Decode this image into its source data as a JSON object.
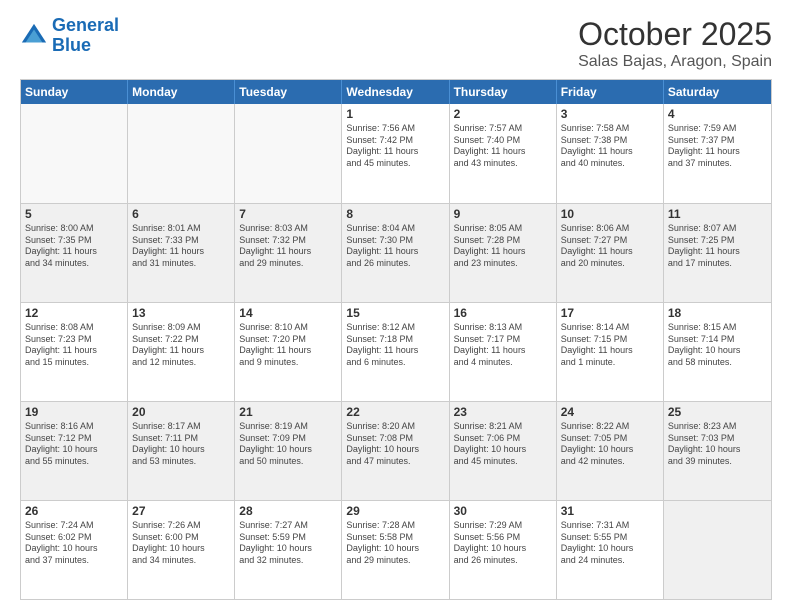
{
  "header": {
    "logo_line1": "General",
    "logo_line2": "Blue",
    "month": "October 2025",
    "location": "Salas Bajas, Aragon, Spain"
  },
  "weekdays": [
    "Sunday",
    "Monday",
    "Tuesday",
    "Wednesday",
    "Thursday",
    "Friday",
    "Saturday"
  ],
  "rows": [
    [
      {
        "day": "",
        "text": ""
      },
      {
        "day": "",
        "text": ""
      },
      {
        "day": "",
        "text": ""
      },
      {
        "day": "1",
        "text": "Sunrise: 7:56 AM\nSunset: 7:42 PM\nDaylight: 11 hours\nand 45 minutes."
      },
      {
        "day": "2",
        "text": "Sunrise: 7:57 AM\nSunset: 7:40 PM\nDaylight: 11 hours\nand 43 minutes."
      },
      {
        "day": "3",
        "text": "Sunrise: 7:58 AM\nSunset: 7:38 PM\nDaylight: 11 hours\nand 40 minutes."
      },
      {
        "day": "4",
        "text": "Sunrise: 7:59 AM\nSunset: 7:37 PM\nDaylight: 11 hours\nand 37 minutes."
      }
    ],
    [
      {
        "day": "5",
        "text": "Sunrise: 8:00 AM\nSunset: 7:35 PM\nDaylight: 11 hours\nand 34 minutes."
      },
      {
        "day": "6",
        "text": "Sunrise: 8:01 AM\nSunset: 7:33 PM\nDaylight: 11 hours\nand 31 minutes."
      },
      {
        "day": "7",
        "text": "Sunrise: 8:03 AM\nSunset: 7:32 PM\nDaylight: 11 hours\nand 29 minutes."
      },
      {
        "day": "8",
        "text": "Sunrise: 8:04 AM\nSunset: 7:30 PM\nDaylight: 11 hours\nand 26 minutes."
      },
      {
        "day": "9",
        "text": "Sunrise: 8:05 AM\nSunset: 7:28 PM\nDaylight: 11 hours\nand 23 minutes."
      },
      {
        "day": "10",
        "text": "Sunrise: 8:06 AM\nSunset: 7:27 PM\nDaylight: 11 hours\nand 20 minutes."
      },
      {
        "day": "11",
        "text": "Sunrise: 8:07 AM\nSunset: 7:25 PM\nDaylight: 11 hours\nand 17 minutes."
      }
    ],
    [
      {
        "day": "12",
        "text": "Sunrise: 8:08 AM\nSunset: 7:23 PM\nDaylight: 11 hours\nand 15 minutes."
      },
      {
        "day": "13",
        "text": "Sunrise: 8:09 AM\nSunset: 7:22 PM\nDaylight: 11 hours\nand 12 minutes."
      },
      {
        "day": "14",
        "text": "Sunrise: 8:10 AM\nSunset: 7:20 PM\nDaylight: 11 hours\nand 9 minutes."
      },
      {
        "day": "15",
        "text": "Sunrise: 8:12 AM\nSunset: 7:18 PM\nDaylight: 11 hours\nand 6 minutes."
      },
      {
        "day": "16",
        "text": "Sunrise: 8:13 AM\nSunset: 7:17 PM\nDaylight: 11 hours\nand 4 minutes."
      },
      {
        "day": "17",
        "text": "Sunrise: 8:14 AM\nSunset: 7:15 PM\nDaylight: 11 hours\nand 1 minute."
      },
      {
        "day": "18",
        "text": "Sunrise: 8:15 AM\nSunset: 7:14 PM\nDaylight: 10 hours\nand 58 minutes."
      }
    ],
    [
      {
        "day": "19",
        "text": "Sunrise: 8:16 AM\nSunset: 7:12 PM\nDaylight: 10 hours\nand 55 minutes."
      },
      {
        "day": "20",
        "text": "Sunrise: 8:17 AM\nSunset: 7:11 PM\nDaylight: 10 hours\nand 53 minutes."
      },
      {
        "day": "21",
        "text": "Sunrise: 8:19 AM\nSunset: 7:09 PM\nDaylight: 10 hours\nand 50 minutes."
      },
      {
        "day": "22",
        "text": "Sunrise: 8:20 AM\nSunset: 7:08 PM\nDaylight: 10 hours\nand 47 minutes."
      },
      {
        "day": "23",
        "text": "Sunrise: 8:21 AM\nSunset: 7:06 PM\nDaylight: 10 hours\nand 45 minutes."
      },
      {
        "day": "24",
        "text": "Sunrise: 8:22 AM\nSunset: 7:05 PM\nDaylight: 10 hours\nand 42 minutes."
      },
      {
        "day": "25",
        "text": "Sunrise: 8:23 AM\nSunset: 7:03 PM\nDaylight: 10 hours\nand 39 minutes."
      }
    ],
    [
      {
        "day": "26",
        "text": "Sunrise: 7:24 AM\nSunset: 6:02 PM\nDaylight: 10 hours\nand 37 minutes."
      },
      {
        "day": "27",
        "text": "Sunrise: 7:26 AM\nSunset: 6:00 PM\nDaylight: 10 hours\nand 34 minutes."
      },
      {
        "day": "28",
        "text": "Sunrise: 7:27 AM\nSunset: 5:59 PM\nDaylight: 10 hours\nand 32 minutes."
      },
      {
        "day": "29",
        "text": "Sunrise: 7:28 AM\nSunset: 5:58 PM\nDaylight: 10 hours\nand 29 minutes."
      },
      {
        "day": "30",
        "text": "Sunrise: 7:29 AM\nSunset: 5:56 PM\nDaylight: 10 hours\nand 26 minutes."
      },
      {
        "day": "31",
        "text": "Sunrise: 7:31 AM\nSunset: 5:55 PM\nDaylight: 10 hours\nand 24 minutes."
      },
      {
        "day": "",
        "text": ""
      }
    ]
  ]
}
